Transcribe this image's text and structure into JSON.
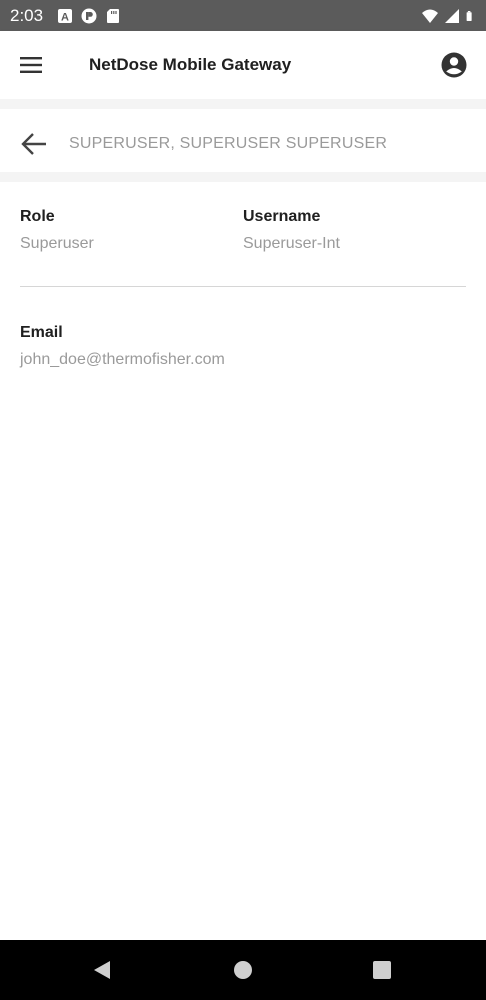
{
  "status_bar": {
    "time": "2:03",
    "left_icons": [
      "a-icon",
      "p-icon",
      "sd-card-icon"
    ],
    "right_icons": [
      "wifi-icon",
      "signal-icon",
      "battery-icon"
    ]
  },
  "app_bar": {
    "title": "NetDose Mobile Gateway",
    "menu_icon": "hamburger-menu-icon",
    "account_icon": "account-circle-icon"
  },
  "subheader": {
    "back_icon": "arrow-left-icon",
    "title": "SUPERUSER, SUPERUSER SUPERUSER"
  },
  "details": {
    "role": {
      "label": "Role",
      "value": "Superuser"
    },
    "username": {
      "label": "Username",
      "value": "Superuser-Int"
    },
    "email": {
      "label": "Email",
      "value": "john_doe@thermofisher.com"
    }
  },
  "nav_bar": {
    "icons": [
      "nav-back-icon",
      "nav-home-icon",
      "nav-recents-icon"
    ]
  },
  "colors": {
    "status_bar": "#5b5b5b",
    "app_bar": "#ffffff",
    "label_text": "#202020",
    "value_text": "#9a9a9a",
    "nav_bar": "#000000"
  }
}
